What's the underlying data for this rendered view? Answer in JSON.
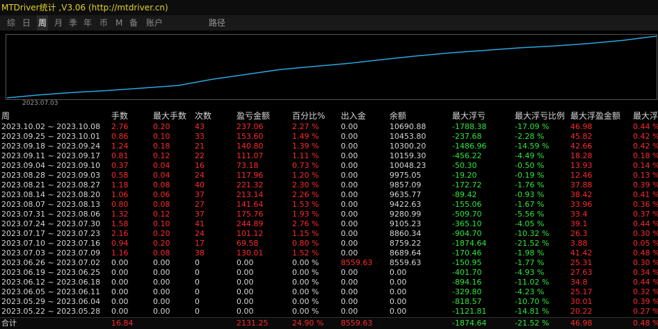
{
  "window": {
    "title": "MTDriver统计 ,V3.06 (http://mtdriver.cn)"
  },
  "tabs": [
    {
      "label": "综",
      "active": false
    },
    {
      "label": "日",
      "active": false
    },
    {
      "label": "周",
      "active": true
    },
    {
      "label": "月",
      "active": false
    },
    {
      "label": "季",
      "active": false
    },
    {
      "label": "年",
      "active": false
    },
    {
      "label": "币",
      "active": false
    },
    {
      "label": "M",
      "active": false
    },
    {
      "label": "备",
      "active": false
    },
    {
      "label": "账户",
      "active": false
    },
    {
      "label": "路径",
      "active": false
    }
  ],
  "chart": {
    "date_label": "2023.07.03",
    "line_color": "#2aa8e0",
    "border_color": "#555555",
    "points": [
      0.0,
      0.05,
      0.09,
      0.12,
      0.16,
      0.2,
      0.3,
      0.38,
      0.46,
      0.51,
      0.56,
      0.62,
      0.68,
      0.73,
      0.77,
      0.81,
      0.84,
      0.88,
      0.93,
      1.0
    ]
  },
  "colors": {
    "positive": "#ff2a2a",
    "negative": "#2ee83a",
    "neutral": "#d6d6d6"
  },
  "table": {
    "headers": [
      "周",
      "手数",
      "最大手数",
      "次数",
      "盈亏金额",
      "百分比%",
      "出入金",
      "余额",
      "最大浮亏",
      "最大浮亏比例",
      "最大浮盈金额",
      "最大浮"
    ],
    "rows": [
      [
        "2023.10.02 ~ 2023.10.08",
        "2.76",
        "0.20",
        "43",
        "237.06",
        "2.27 %",
        "0.00",
        "10690.88",
        "-1788.38",
        "-17.09 %",
        "46.98",
        "0.44 %"
      ],
      [
        "2023.09.25 ~ 2023.10.01",
        "0.86",
        "0.10",
        "33",
        "153.60",
        "1.49 %",
        "0.00",
        "10453.80",
        "-237.68",
        "-2.28 %",
        "45.82",
        "0.42 %"
      ],
      [
        "2023.09.18 ~ 2023.09.24",
        "1.24",
        "0.18",
        "21",
        "140.80",
        "1.39 %",
        "0.00",
        "10300.20",
        "-1486.96",
        "-14.59 %",
        "42.66",
        "0.42 %"
      ],
      [
        "2023.09.11 ~ 2023.09.17",
        "0.81",
        "0.12",
        "22",
        "111.07",
        "1.11 %",
        "0.00",
        "10159.30",
        "-456.22",
        "-4.49 %",
        "18.28",
        "0.18 %"
      ],
      [
        "2023.09.04 ~ 2023.09.10",
        "0.37",
        "0.04",
        "16",
        "73.18",
        "0.73 %",
        "0.00",
        "10048.23",
        "-50.30",
        "-0.50 %",
        "13.93",
        "0.14 %"
      ],
      [
        "2023.08.28 ~ 2023.09.03",
        "0.58",
        "0.04",
        "24",
        "117.96",
        "1.20 %",
        "0.00",
        "9975.05",
        "-19.20",
        "-0.19 %",
        "12.46",
        "0.13 %"
      ],
      [
        "2023.08.21 ~ 2023.08.27",
        "1.18",
        "0.08",
        "40",
        "221.32",
        "2.30 %",
        "0.00",
        "9857.09",
        "-172.72",
        "-1.76 %",
        "37.88",
        "0.39 %"
      ],
      [
        "2023.08.14 ~ 2023.08.20",
        "1.06",
        "0.06",
        "37",
        "213.14",
        "2.26 %",
        "0.00",
        "9635.77",
        "-89.42",
        "-0.93 %",
        "38.42",
        "0.41 %"
      ],
      [
        "2023.08.07 ~ 2023.08.13",
        "0.80",
        "0.08",
        "27",
        "141.64",
        "1.53 %",
        "0.00",
        "9422.63",
        "-155.06",
        "-1.67 %",
        "33.96",
        "0.36 %"
      ],
      [
        "2023.07.31 ~ 2023.08.06",
        "1.32",
        "0.12",
        "37",
        "175.76",
        "1.93 %",
        "0.00",
        "9280.99",
        "-509.70",
        "-5.56 %",
        "33.4",
        "0.37 %"
      ],
      [
        "2023.07.24 ~ 2023.07.30",
        "1.58",
        "0.10",
        "41",
        "244.89",
        "2.76 %",
        "0.00",
        "9105.23",
        "-365.10",
        "-4.05 %",
        "39.1",
        "0.44 %"
      ],
      [
        "2023.07.17 ~ 2023.07.23",
        "2.16",
        "0.20",
        "24",
        "101.12",
        "1.15 %",
        "0.00",
        "8860.34",
        "-904.70",
        "-10.32 %",
        "26.3",
        "0.30 %"
      ],
      [
        "2023.07.10 ~ 2023.07.16",
        "0.94",
        "0.20",
        "17",
        "69.58",
        "0.80 %",
        "0.00",
        "8759.22",
        "-1874.64",
        "-21.52 %",
        "3.88",
        "0.05 %"
      ],
      [
        "2023.07.03 ~ 2023.07.09",
        "1.16",
        "0.08",
        "38",
        "130.01",
        "1.52 %",
        "0.00",
        "8689.64",
        "-170.46",
        "-1.98 %",
        "41.42",
        "0.48 %"
      ],
      [
        "2023.06.26 ~ 2023.07.02",
        "0.00",
        "0.00",
        "0",
        "0.00",
        "0.00 %",
        "8559.63",
        "8559.63",
        "-150.95",
        "-1.77 %",
        "25.31",
        "0.30 %"
      ],
      [
        "2023.06.19 ~ 2023.06.25",
        "0.00",
        "0.00",
        "0",
        "0.00",
        "0.00 %",
        "0.00",
        "0.00",
        "-401.70",
        "-4.93 %",
        "27.63",
        "0.34 %"
      ],
      [
        "2023.06.12 ~ 2023.06.18",
        "0.00",
        "0.00",
        "0",
        "0.00",
        "0.00 %",
        "0.00",
        "0.00",
        "-894.16",
        "-11.02 %",
        "34.8",
        "0.44 %"
      ],
      [
        "2023.06.05 ~ 2023.06.11",
        "0.00",
        "0.00",
        "0",
        "0.00",
        "0.00 %",
        "0.00",
        "0.00",
        "-329.80",
        "-4.23 %",
        "25.17",
        "0.32 %"
      ],
      [
        "2023.05.29 ~ 2023.06.04",
        "0.00",
        "0.00",
        "0",
        "0.00",
        "0.00 %",
        "0.00",
        "0.00",
        "-818.57",
        "-10.70 %",
        "30.01",
        "0.39 %"
      ],
      [
        "2023.05.22 ~ 2023.05.28",
        "0.00",
        "0.00",
        "0",
        "0.00",
        "0.00 %",
        "0.00",
        "0.00",
        "-1121.81",
        "-14.81 %",
        "20.22",
        "0.27 %"
      ]
    ],
    "total": [
      "合计",
      "16.84",
      "",
      "",
      "2131.25",
      "24.90 %",
      "8559.63",
      "",
      "-1874.64",
      "-21.52 %",
      "46.98",
      "0.48 %"
    ]
  }
}
